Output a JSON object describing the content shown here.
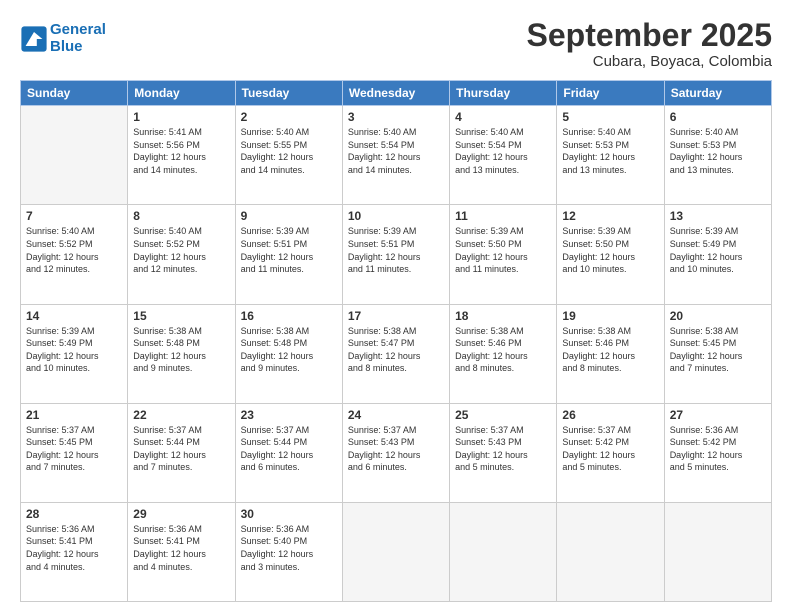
{
  "header": {
    "logo_line1": "General",
    "logo_line2": "Blue",
    "month": "September 2025",
    "location": "Cubara, Boyaca, Colombia"
  },
  "weekdays": [
    "Sunday",
    "Monday",
    "Tuesday",
    "Wednesday",
    "Thursday",
    "Friday",
    "Saturday"
  ],
  "weeks": [
    [
      {
        "day": "",
        "info": ""
      },
      {
        "day": "1",
        "info": "Sunrise: 5:41 AM\nSunset: 5:56 PM\nDaylight: 12 hours\nand 14 minutes."
      },
      {
        "day": "2",
        "info": "Sunrise: 5:40 AM\nSunset: 5:55 PM\nDaylight: 12 hours\nand 14 minutes."
      },
      {
        "day": "3",
        "info": "Sunrise: 5:40 AM\nSunset: 5:54 PM\nDaylight: 12 hours\nand 14 minutes."
      },
      {
        "day": "4",
        "info": "Sunrise: 5:40 AM\nSunset: 5:54 PM\nDaylight: 12 hours\nand 13 minutes."
      },
      {
        "day": "5",
        "info": "Sunrise: 5:40 AM\nSunset: 5:53 PM\nDaylight: 12 hours\nand 13 minutes."
      },
      {
        "day": "6",
        "info": "Sunrise: 5:40 AM\nSunset: 5:53 PM\nDaylight: 12 hours\nand 13 minutes."
      }
    ],
    [
      {
        "day": "7",
        "info": "Sunrise: 5:40 AM\nSunset: 5:52 PM\nDaylight: 12 hours\nand 12 minutes."
      },
      {
        "day": "8",
        "info": "Sunrise: 5:40 AM\nSunset: 5:52 PM\nDaylight: 12 hours\nand 12 minutes."
      },
      {
        "day": "9",
        "info": "Sunrise: 5:39 AM\nSunset: 5:51 PM\nDaylight: 12 hours\nand 11 minutes."
      },
      {
        "day": "10",
        "info": "Sunrise: 5:39 AM\nSunset: 5:51 PM\nDaylight: 12 hours\nand 11 minutes."
      },
      {
        "day": "11",
        "info": "Sunrise: 5:39 AM\nSunset: 5:50 PM\nDaylight: 12 hours\nand 11 minutes."
      },
      {
        "day": "12",
        "info": "Sunrise: 5:39 AM\nSunset: 5:50 PM\nDaylight: 12 hours\nand 10 minutes."
      },
      {
        "day": "13",
        "info": "Sunrise: 5:39 AM\nSunset: 5:49 PM\nDaylight: 12 hours\nand 10 minutes."
      }
    ],
    [
      {
        "day": "14",
        "info": "Sunrise: 5:39 AM\nSunset: 5:49 PM\nDaylight: 12 hours\nand 10 minutes."
      },
      {
        "day": "15",
        "info": "Sunrise: 5:38 AM\nSunset: 5:48 PM\nDaylight: 12 hours\nand 9 minutes."
      },
      {
        "day": "16",
        "info": "Sunrise: 5:38 AM\nSunset: 5:48 PM\nDaylight: 12 hours\nand 9 minutes."
      },
      {
        "day": "17",
        "info": "Sunrise: 5:38 AM\nSunset: 5:47 PM\nDaylight: 12 hours\nand 8 minutes."
      },
      {
        "day": "18",
        "info": "Sunrise: 5:38 AM\nSunset: 5:46 PM\nDaylight: 12 hours\nand 8 minutes."
      },
      {
        "day": "19",
        "info": "Sunrise: 5:38 AM\nSunset: 5:46 PM\nDaylight: 12 hours\nand 8 minutes."
      },
      {
        "day": "20",
        "info": "Sunrise: 5:38 AM\nSunset: 5:45 PM\nDaylight: 12 hours\nand 7 minutes."
      }
    ],
    [
      {
        "day": "21",
        "info": "Sunrise: 5:37 AM\nSunset: 5:45 PM\nDaylight: 12 hours\nand 7 minutes."
      },
      {
        "day": "22",
        "info": "Sunrise: 5:37 AM\nSunset: 5:44 PM\nDaylight: 12 hours\nand 7 minutes."
      },
      {
        "day": "23",
        "info": "Sunrise: 5:37 AM\nSunset: 5:44 PM\nDaylight: 12 hours\nand 6 minutes."
      },
      {
        "day": "24",
        "info": "Sunrise: 5:37 AM\nSunset: 5:43 PM\nDaylight: 12 hours\nand 6 minutes."
      },
      {
        "day": "25",
        "info": "Sunrise: 5:37 AM\nSunset: 5:43 PM\nDaylight: 12 hours\nand 5 minutes."
      },
      {
        "day": "26",
        "info": "Sunrise: 5:37 AM\nSunset: 5:42 PM\nDaylight: 12 hours\nand 5 minutes."
      },
      {
        "day": "27",
        "info": "Sunrise: 5:36 AM\nSunset: 5:42 PM\nDaylight: 12 hours\nand 5 minutes."
      }
    ],
    [
      {
        "day": "28",
        "info": "Sunrise: 5:36 AM\nSunset: 5:41 PM\nDaylight: 12 hours\nand 4 minutes."
      },
      {
        "day": "29",
        "info": "Sunrise: 5:36 AM\nSunset: 5:41 PM\nDaylight: 12 hours\nand 4 minutes."
      },
      {
        "day": "30",
        "info": "Sunrise: 5:36 AM\nSunset: 5:40 PM\nDaylight: 12 hours\nand 3 minutes."
      },
      {
        "day": "",
        "info": ""
      },
      {
        "day": "",
        "info": ""
      },
      {
        "day": "",
        "info": ""
      },
      {
        "day": "",
        "info": ""
      }
    ]
  ]
}
